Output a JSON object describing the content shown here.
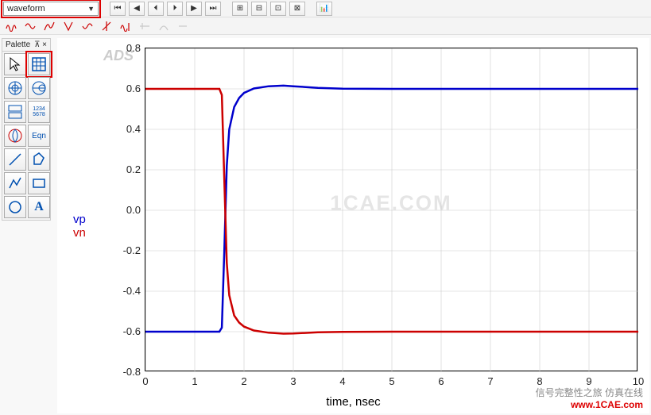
{
  "dropdown": {
    "value": "waveform"
  },
  "palette": {
    "title": "Palette",
    "pin_label": "⊼ ×"
  },
  "toolbar_icons": {
    "nav_first": "⏮",
    "nav_prev": "◀",
    "nav_play_rev": "⏴",
    "nav_play": "⏵",
    "nav_next": "▶",
    "nav_last": "⏭",
    "zoom_in": "⊞",
    "zoom_out": "⊟",
    "zoom_fit": "⊡",
    "zoom_sel": "⊠",
    "export": "📊"
  },
  "watermarks": {
    "ads": "ADS",
    "center": "1CAE.COM",
    "footer_cn": "信号完整性之旅  仿真在线",
    "footer_url": "www.1CAE.com"
  },
  "chart_data": {
    "type": "line",
    "xlabel": "time, nsec",
    "ylabel_series": [
      "vp",
      "vn"
    ],
    "xlim": [
      0,
      10
    ],
    "ylim": [
      -0.8,
      0.8
    ],
    "xticks": [
      0,
      1,
      2,
      3,
      4,
      5,
      6,
      7,
      8,
      9,
      10
    ],
    "yticks": [
      -0.8,
      -0.6,
      -0.4,
      -0.2,
      0.0,
      0.2,
      0.4,
      0.6,
      0.8
    ],
    "x": [
      0.0,
      1.4,
      1.5,
      1.55,
      1.6,
      1.65,
      1.7,
      1.8,
      1.9,
      2.0,
      2.2,
      2.5,
      2.8,
      3.0,
      3.5,
      4.0,
      5.0,
      6.0,
      8.0,
      10.0
    ],
    "series": [
      {
        "name": "vp",
        "color": "#0000cc",
        "values": [
          -0.6,
          -0.6,
          -0.6,
          -0.58,
          -0.2,
          0.22,
          0.4,
          0.51,
          0.555,
          0.58,
          0.602,
          0.613,
          0.616,
          0.613,
          0.605,
          0.601,
          0.6,
          0.6,
          0.6,
          0.6
        ]
      },
      {
        "name": "vn",
        "color": "#cc0000",
        "values": [
          0.6,
          0.6,
          0.6,
          0.57,
          0.15,
          -0.26,
          -0.42,
          -0.52,
          -0.555,
          -0.575,
          -0.594,
          -0.605,
          -0.61,
          -0.609,
          -0.603,
          -0.601,
          -0.6,
          -0.6,
          -0.6,
          -0.6
        ]
      }
    ]
  }
}
